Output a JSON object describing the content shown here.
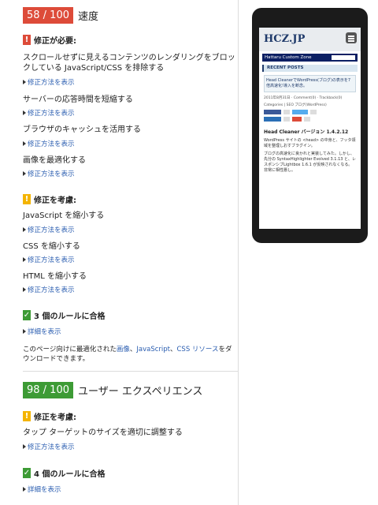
{
  "speed": {
    "score": "58 / 100",
    "label": "速度",
    "must_fix": {
      "title": "修正が必要:",
      "rules": [
        {
          "text": "スクロールせずに見えるコンテンツのレンダリングをブロックしている JavaScript/CSS を排除する",
          "link": "修正方法を表示"
        },
        {
          "text": "サーバーの応答時間を短縮する",
          "link": "修正方法を表示"
        },
        {
          "text": "ブラウザのキャッシュを活用する",
          "link": "修正方法を表示"
        },
        {
          "text": "画像を最適化する",
          "link": "修正方法を表示"
        }
      ]
    },
    "consider": {
      "title": "修正を考慮:",
      "rules": [
        {
          "text": "JavaScript を縮小する",
          "link": "修正方法を表示"
        },
        {
          "text": "CSS を縮小する",
          "link": "修正方法を表示"
        },
        {
          "text": "HTML を縮小する",
          "link": "修正方法を表示"
        }
      ]
    },
    "passed": {
      "title": "3 個のルールに合格",
      "link": "詳細を表示"
    },
    "download": {
      "prefix": "このページ向けに最適化された",
      "images": "画像",
      "sep1": "、",
      "javascript": "JavaScript",
      "sep2": "、",
      "css": "CSS リソース",
      "suffix": "をダウンロードできます。"
    }
  },
  "ux": {
    "score": "98 / 100",
    "label": "ユーザー エクスペリエンス",
    "consider": {
      "title": "修正を考慮:",
      "rules": [
        {
          "text": "タップ ターゲットのサイズを適切に調整する",
          "link": "修正方法を表示"
        }
      ]
    },
    "passed": {
      "title": "4 個のルールに合格",
      "link": "詳細を表示"
    }
  },
  "phone": {
    "logo": "HCZ.JP",
    "site_title": "Hattaru Custom Zone",
    "recent": "RECENT POSTS",
    "post": "Head CleanerでWordPress(ブログ)の表示を7倍高速化!導入を断念。",
    "meta": "2011年8月31日 · Comment(0) · Trackback(0)",
    "categories": "Categories | SEO ブログ(WordPress)",
    "article_title": "Head Cleaner バージョン 1.4.2.12",
    "para1": "WordPress サイトの <head> の中身と、フッタ領域を整理しおすブラグイン。",
    "para2": "ブログの高速化に良かれと実装してみた。しかし、先分の SyntaxHighlighter Evolved 3.1.13 と、レスポンシブLightbox 1.6.1 が反映されなくなる。非常に相性悪し。"
  },
  "colors": {
    "red": "#dd4b39",
    "yellow": "#f4b400",
    "green": "#3d9b35",
    "link": "#2a5db0"
  },
  "icons": {
    "must_fix": "exclamation-icon",
    "consider": "exclamation-icon",
    "passed": "checkmark-icon",
    "link": "triangle-right-icon"
  }
}
